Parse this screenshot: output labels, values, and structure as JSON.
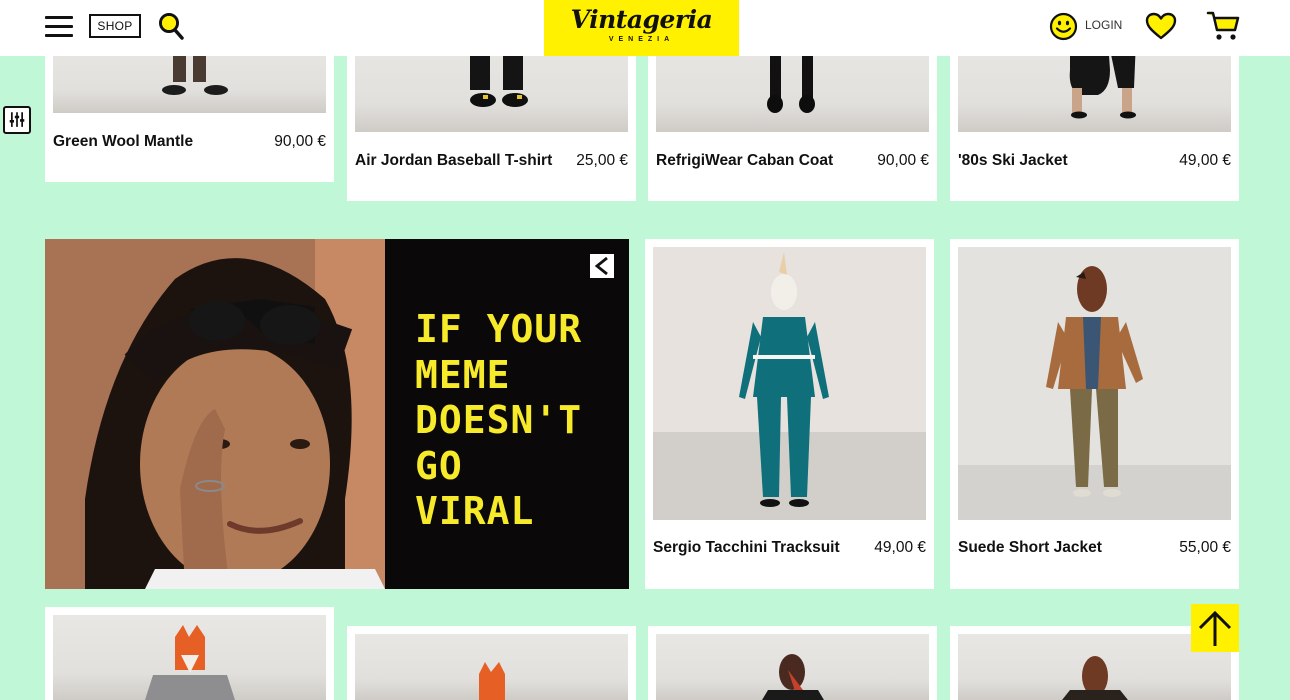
{
  "header": {
    "shop_label": "SHOP",
    "logo_text": "Vintageria",
    "logo_sub": "VENEZIA",
    "login_label": "LOGIN"
  },
  "products": [
    {
      "name": "Green Wool Mantle",
      "price": "90,00 €"
    },
    {
      "name": "Air Jordan Baseball T-shirt",
      "price": "25,00 €"
    },
    {
      "name": "RefrigiWear Caban Coat",
      "price": "90,00 €"
    },
    {
      "name": "'80s Ski Jacket",
      "price": "49,00 €"
    },
    {
      "name": "Sergio Tacchini Tracksuit",
      "price": "49,00 €"
    },
    {
      "name": "Suede Short Jacket",
      "price": "55,00 €"
    }
  ],
  "banner": {
    "lines": [
      "IF YOUR",
      "MEME",
      "DOESN'T",
      "GO",
      "VIRAL"
    ]
  },
  "colors": {
    "background": "#c0f7d6",
    "accent_yellow": "#fff100",
    "meme_text": "#f7ea2a"
  },
  "icons": [
    "menu-icon",
    "search-icon",
    "smiley-icon",
    "heart-icon",
    "cart-icon",
    "filter-icon",
    "share-icon",
    "arrow-up-icon"
  ]
}
